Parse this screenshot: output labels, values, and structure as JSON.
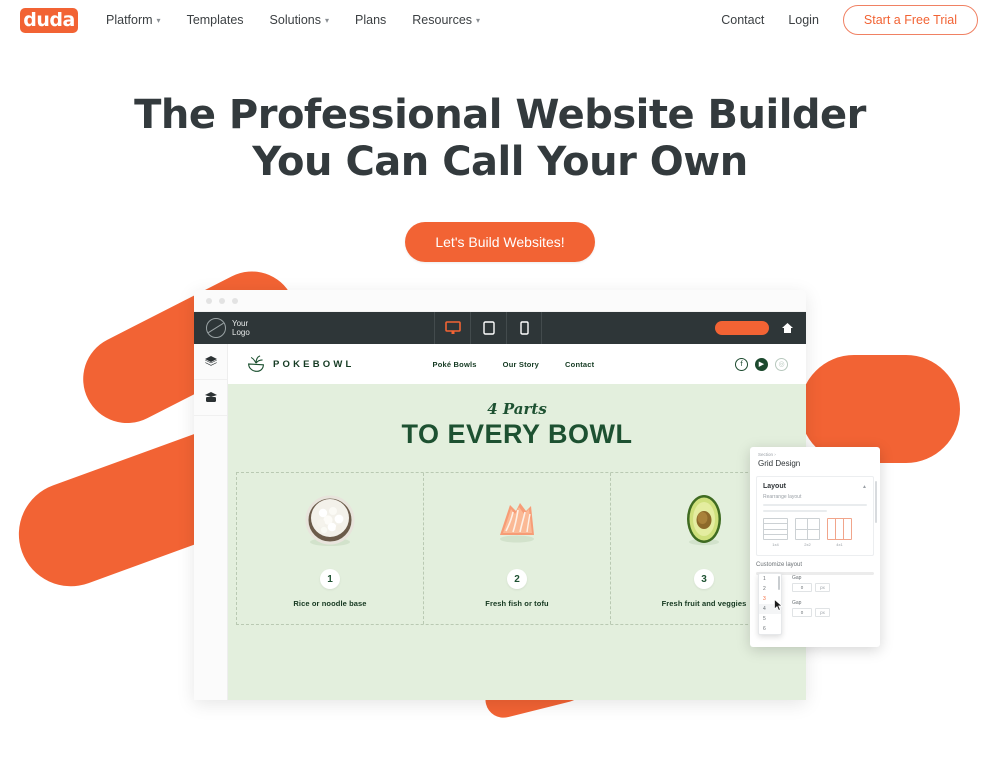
{
  "nav": {
    "logo_text": "duda",
    "items": [
      {
        "label": "Platform",
        "has_caret": true,
        "icon": "chevron-down-icon"
      },
      {
        "label": "Templates",
        "has_caret": false
      },
      {
        "label": "Solutions",
        "has_caret": true,
        "icon": "chevron-down-icon"
      },
      {
        "label": "Plans",
        "has_caret": false
      },
      {
        "label": "Resources",
        "has_caret": true,
        "icon": "chevron-down-icon"
      }
    ],
    "contact": "Contact",
    "login": "Login",
    "trial_button": "Start a Free Trial",
    "caret_glyph": "▾"
  },
  "hero": {
    "line1": "The Professional Website Builder",
    "line2": "You Can Call Your Own",
    "cta": "Let's Build Websites!"
  },
  "editor": {
    "logo_label_line1": "Your",
    "logo_label_line2": "Logo",
    "devices": [
      {
        "name": "desktop-view-icon",
        "active": true
      },
      {
        "name": "tablet-view-icon",
        "active": false
      },
      {
        "name": "mobile-view-icon",
        "active": false
      }
    ],
    "home_icon": "home-icon",
    "rail": [
      {
        "icon": "layers-icon"
      },
      {
        "icon": "sections-icon"
      }
    ]
  },
  "site": {
    "brand": "POKEBOWL",
    "nav": [
      "Poké Bowls",
      "Our Story",
      "Contact"
    ],
    "socials": [
      {
        "name": "facebook-icon",
        "glyph": "f"
      },
      {
        "name": "youtube-icon",
        "glyph": "▶"
      },
      {
        "name": "instagram-icon",
        "glyph": "◎"
      }
    ],
    "script_title": "4 Parts",
    "big_title": "TO EVERY BOWL",
    "cards": [
      {
        "number": "1",
        "label": "Rice or noodle base",
        "image": "rice-bowl-image"
      },
      {
        "number": "2",
        "label": "Fresh fish or tofu",
        "image": "salmon-image"
      },
      {
        "number": "3",
        "label": "Fresh fruit and veggies",
        "image": "avocado-image"
      }
    ]
  },
  "panel": {
    "breadcrumb": "Section ›",
    "title": "Grid Design",
    "section_title": "Layout",
    "collapse_icon": "chevron-up-icon",
    "rearrange_label": "Rearrange layout",
    "layout_options": [
      {
        "label": "1x4",
        "selected": false
      },
      {
        "label": "2x2",
        "selected": false
      },
      {
        "label": "4x1",
        "selected": true
      }
    ],
    "customize_label": "Customize layout",
    "dropdown_options": [
      "1",
      "2",
      "3",
      "4",
      "5",
      "6"
    ],
    "dropdown_selected": "3",
    "dropdown_hover": "4",
    "fields": [
      {
        "label": "Gap",
        "value": "0",
        "unit": "px"
      },
      {
        "label": "Gap",
        "value": "0",
        "unit": "px"
      }
    ],
    "cursor_icon": "mouse-cursor-icon"
  },
  "colors": {
    "brand_orange": "#f26334",
    "dark": "#2e3638",
    "site_green": "#e3efdd",
    "deep_green": "#1d5131"
  }
}
